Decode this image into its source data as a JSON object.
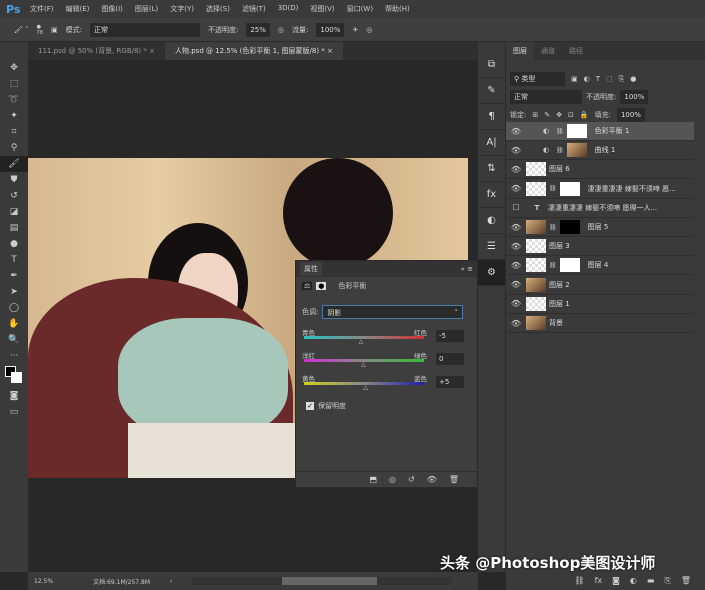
{
  "app": {
    "logo": "Ps"
  },
  "menu": [
    "文件(F)",
    "编辑(E)",
    "图像(I)",
    "图层(L)",
    "文字(Y)",
    "选择(S)",
    "滤镜(T)",
    "3D(D)",
    "视图(V)",
    "窗口(W)",
    "帮助(H)"
  ],
  "options": {
    "brush_size": "78",
    "mode_label": "模式:",
    "mode_value": "正常",
    "opacity_label": "不透明度:",
    "opacity_value": "25%",
    "flow_label": "流量:",
    "flow_value": "100%"
  },
  "tabs": [
    {
      "label": "111.psd @ 50% (背景, RGB/8) *",
      "active": false
    },
    {
      "label": "人物.psd @ 12.5% (色彩平衡 1, 图层蒙版/8) *",
      "active": true
    }
  ],
  "properties": {
    "title": "属性",
    "adjustment": "色彩平衡",
    "tone_label": "色调:",
    "tone_value": "阴影",
    "sliders": [
      {
        "left": "青色",
        "right": "红色",
        "value": "-5",
        "pos": 0.48
      },
      {
        "left": "洋红",
        "right": "绿色",
        "value": "0",
        "pos": 0.5
      },
      {
        "left": "黄色",
        "right": "蓝色",
        "value": "+5",
        "pos": 0.52
      }
    ],
    "preserve_luminosity": "保留明度",
    "preserve_checked": true
  },
  "layers_panel": {
    "tabs": [
      "图层",
      "通道",
      "路径"
    ],
    "filter": "类型",
    "blend": "正常",
    "opacity_label": "不透明度:",
    "opacity_value": "100%",
    "lock_label": "锁定:",
    "fill_label": "填充:",
    "fill_value": "100%",
    "layers": [
      {
        "name": "色彩平衡 1",
        "visible": true,
        "thumb": "adj",
        "mask": "white",
        "selected": true
      },
      {
        "name": "曲线 1",
        "visible": true,
        "thumb": "adj",
        "mask": "photo"
      },
      {
        "name": "图层 6",
        "visible": true,
        "thumb": "trans"
      },
      {
        "name": "凄凄重凄凄 嫁娶不须啼 愿...",
        "visible": true,
        "thumb": "trans",
        "mask": "white"
      },
      {
        "name": "凄凄重凄凄 嫁娶不须啼 愿得一人...",
        "visible": false,
        "thumb": "text"
      },
      {
        "name": "图层 5",
        "visible": true,
        "thumb": "photo",
        "mask": "black"
      },
      {
        "name": "图层 3",
        "visible": true,
        "thumb": "trans"
      },
      {
        "name": "图层 4",
        "visible": true,
        "thumb": "trans",
        "mask": "white"
      },
      {
        "name": "图层 2",
        "visible": true,
        "thumb": "photo"
      },
      {
        "name": "图层 1",
        "visible": true,
        "thumb": "trans"
      },
      {
        "name": "背景",
        "visible": true,
        "thumb": "photo"
      }
    ]
  },
  "status": {
    "zoom": "12.5%",
    "doc": "文档:69.1M/257.8M"
  },
  "watermark": "头条 @Photoshop美图设计师"
}
